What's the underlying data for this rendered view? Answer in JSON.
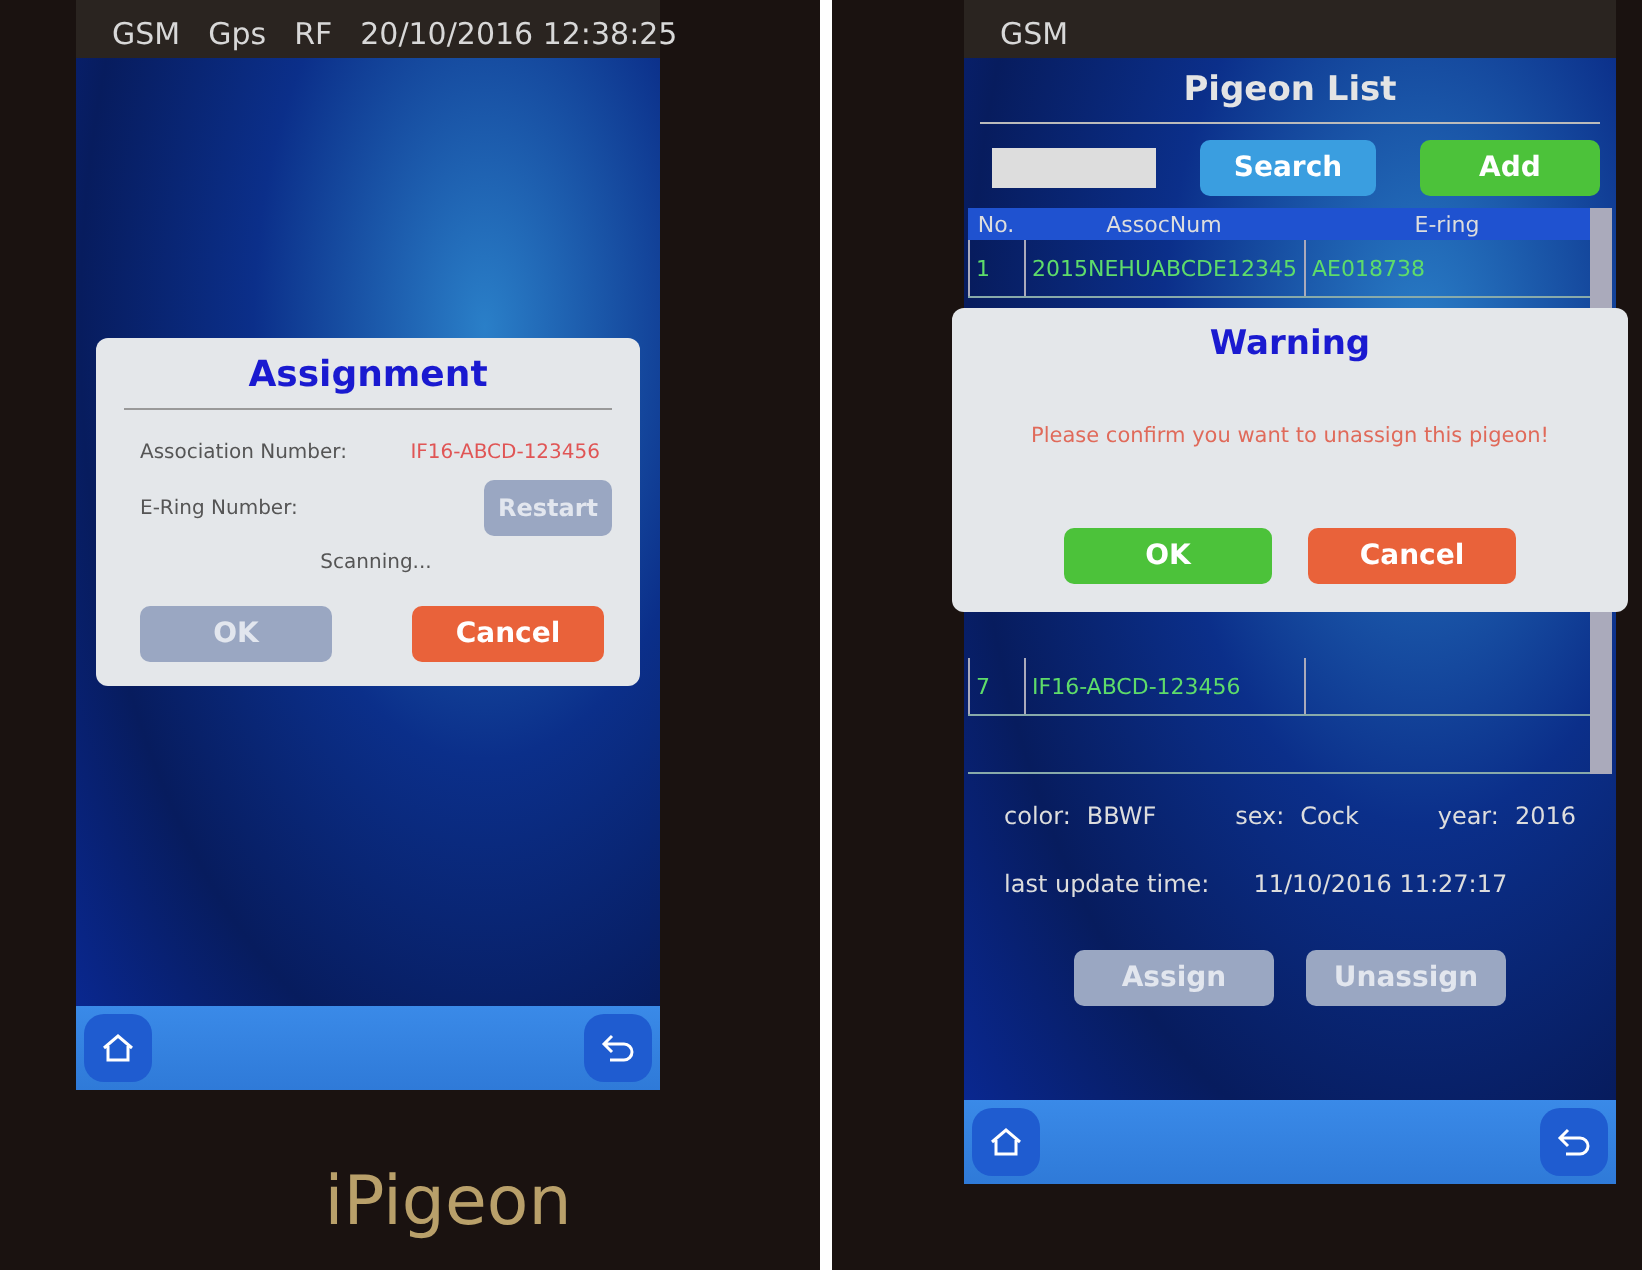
{
  "left_screen": {
    "status_bar": {
      "items": [
        "GSM",
        "Gps",
        "RF",
        "20/10/2016 12:38:25"
      ]
    },
    "dialog": {
      "title": "Assignment",
      "fields": [
        {
          "label": "Association Number:",
          "value": "IF16-ABCD-123456"
        },
        {
          "label": "E-Ring Number:",
          "button": {
            "label": "Restart",
            "disabled": true
          }
        }
      ],
      "status": "Scanning...",
      "buttons": [
        {
          "label": "OK",
          "kind": "neutral",
          "disabled": true
        },
        {
          "label": "Cancel",
          "kind": "danger",
          "disabled": false
        }
      ]
    },
    "brand": "iPigeon"
  },
  "right_screen": {
    "status_bar": {
      "items": [
        "GSM"
      ]
    },
    "title": "Pigeon List",
    "search": {
      "button": "Search"
    },
    "add_button": "Add",
    "table": {
      "columns": [
        "No.",
        "AssocNum",
        "E-ring"
      ],
      "rows": [
        [
          "1",
          "2015NEHUABCDE12345",
          "AE018738"
        ],
        [
          "7",
          "IF16-ABCD-123456",
          ""
        ]
      ]
    },
    "dialog": {
      "title": "Warning",
      "message": "Please confirm you want to unassign this pigeon!",
      "buttons": [
        {
          "label": "OK",
          "kind": "confirm",
          "disabled": false
        },
        {
          "label": "Cancel",
          "kind": "danger",
          "disabled": false
        }
      ]
    },
    "details": [
      {
        "label": "color:",
        "value": "BBWF"
      },
      {
        "label": "sex:",
        "value": "Cock"
      },
      {
        "label": "year:",
        "value": "2016"
      }
    ],
    "last_update": {
      "label": "last update time:",
      "value": "11/10/2016 11:27:17"
    },
    "actions": [
      {
        "label": "Assign",
        "disabled": true
      },
      {
        "label": "Unassign",
        "disabled": true
      }
    ]
  }
}
